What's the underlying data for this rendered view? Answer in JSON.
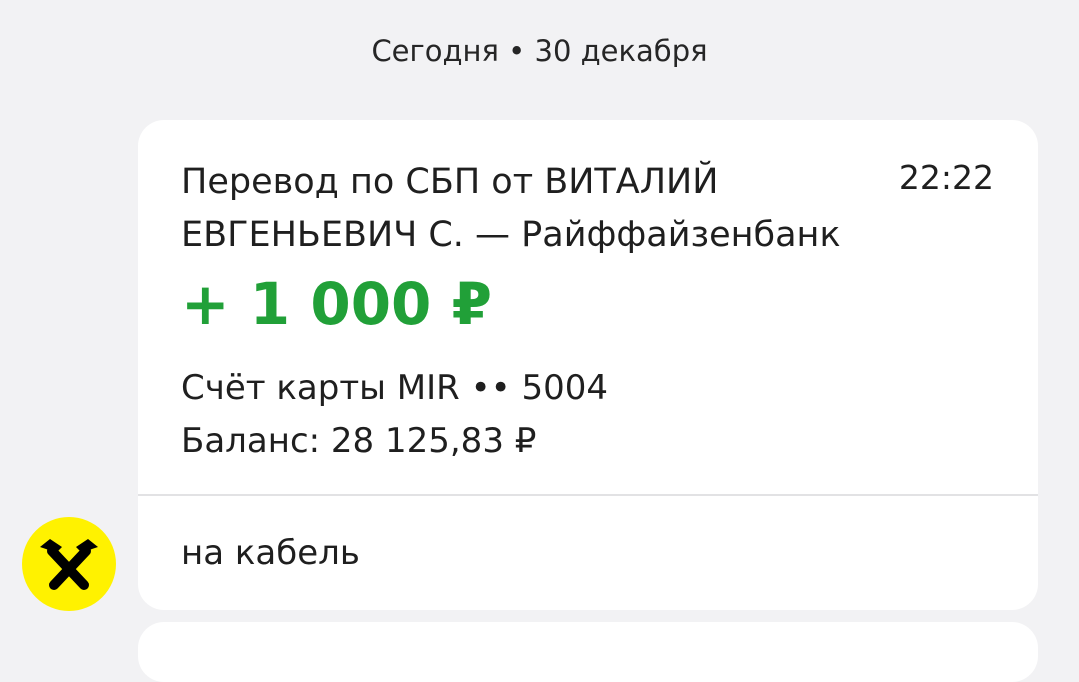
{
  "date_header": "Сегодня • 30 декабря",
  "transaction": {
    "title": "Перевод по СБП от ВИТАЛИЙ ЕВГЕНЬЕВИЧ С. — Райффайзенбанк",
    "time": "22:22",
    "amount": "+ 1 000 ₽",
    "account": "Счёт карты MIR •• 5004",
    "balance": "Баланс: 28 125,83 ₽",
    "comment": "на кабель"
  },
  "sender": {
    "avatar_icon": "raiffeisen-logo-icon",
    "avatar_color": "#fff200"
  },
  "colors": {
    "amount_positive": "#21a038",
    "background": "#f2f2f4",
    "card": "#ffffff"
  }
}
